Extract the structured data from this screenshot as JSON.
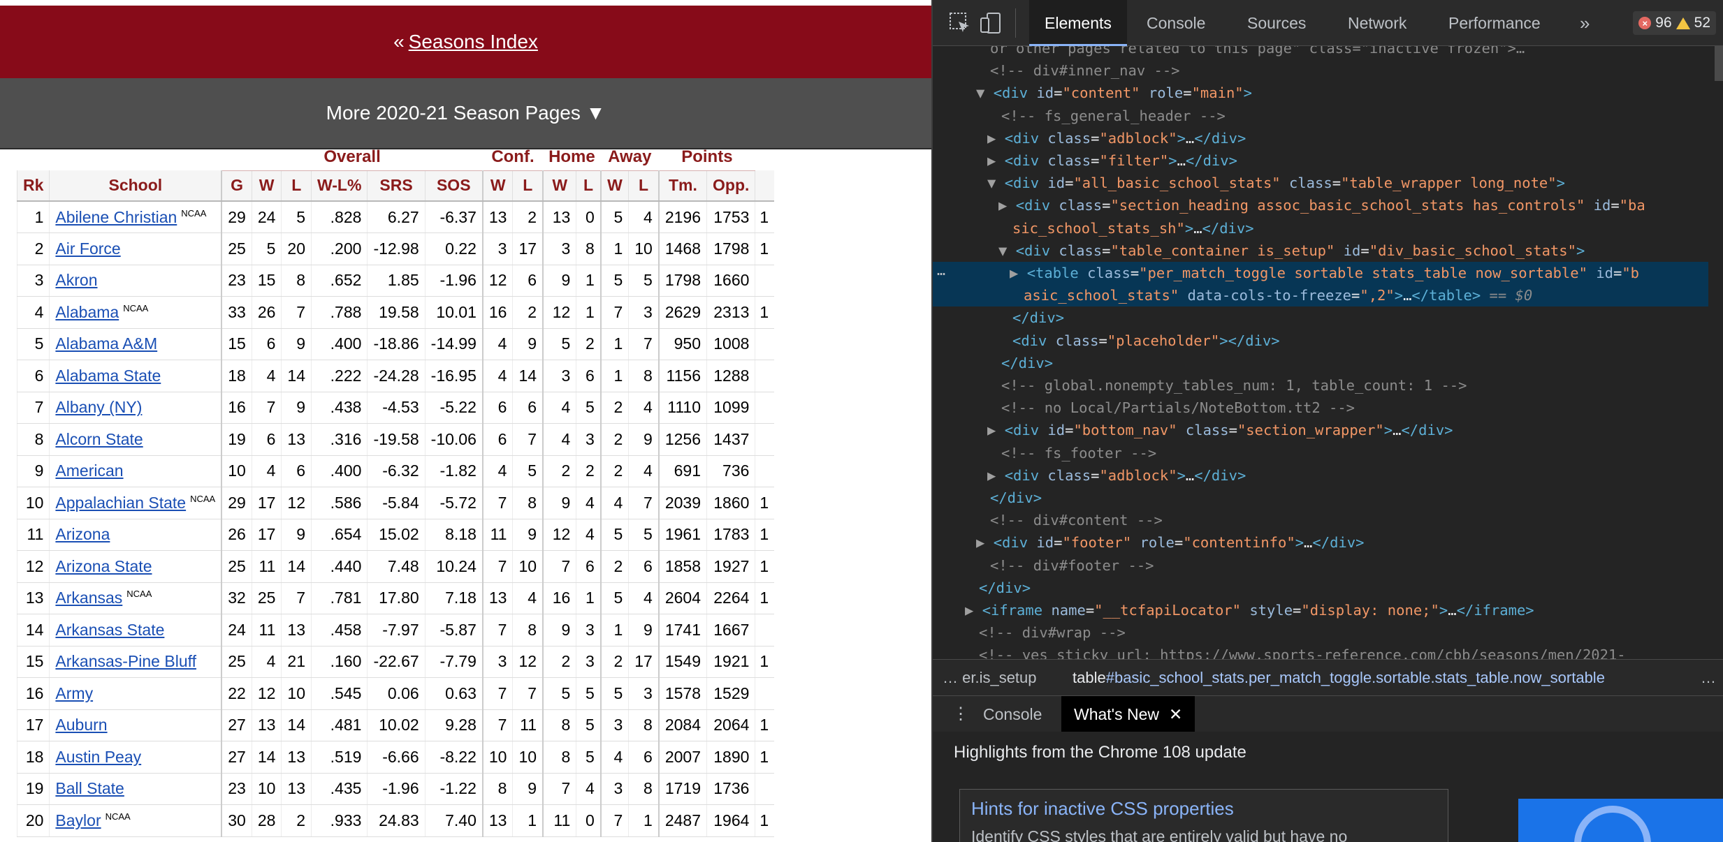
{
  "page": {
    "top_nav": {
      "prefix": "«",
      "link": "Seasons Index"
    },
    "more_pages": {
      "label": "More 2020-21 Season Pages ▼"
    },
    "table": {
      "over_headers": [
        "Overall",
        "Conf.",
        "Home",
        "Away",
        "Points"
      ],
      "headers": [
        "Rk",
        "School",
        "G",
        "W",
        "L",
        "W-L%",
        "SRS",
        "SOS",
        "W",
        "L",
        "W",
        "L",
        "W",
        "L",
        "Tm.",
        "Opp."
      ],
      "rows": [
        {
          "rk": "1",
          "school": "Abilene Christian",
          "ncaa": "NCAA",
          "g": "29",
          "w": "24",
          "l": "5",
          "wl": ".828",
          "srs": "6.27",
          "sos": "-6.37",
          "cw": "13",
          "cl": "2",
          "hw": "13",
          "hl": "0",
          "aw": "5",
          "al": "4",
          "tm": "2196",
          "opp": "1753",
          "more": "1"
        },
        {
          "rk": "2",
          "school": "Air Force",
          "ncaa": "",
          "g": "25",
          "w": "5",
          "l": "20",
          "wl": ".200",
          "srs": "-12.98",
          "sos": "0.22",
          "cw": "3",
          "cl": "17",
          "hw": "3",
          "hl": "8",
          "aw": "1",
          "al": "10",
          "tm": "1468",
          "opp": "1798",
          "more": "1"
        },
        {
          "rk": "3",
          "school": "Akron",
          "ncaa": "",
          "g": "23",
          "w": "15",
          "l": "8",
          "wl": ".652",
          "srs": "1.85",
          "sos": "-1.96",
          "cw": "12",
          "cl": "6",
          "hw": "9",
          "hl": "1",
          "aw": "5",
          "al": "5",
          "tm": "1798",
          "opp": "1660",
          "more": ""
        },
        {
          "rk": "4",
          "school": "Alabama",
          "ncaa": "NCAA",
          "g": "33",
          "w": "26",
          "l": "7",
          "wl": ".788",
          "srs": "19.58",
          "sos": "10.01",
          "cw": "16",
          "cl": "2",
          "hw": "12",
          "hl": "1",
          "aw": "7",
          "al": "3",
          "tm": "2629",
          "opp": "2313",
          "more": "1"
        },
        {
          "rk": "5",
          "school": "Alabama A&M",
          "ncaa": "",
          "g": "15",
          "w": "6",
          "l": "9",
          "wl": ".400",
          "srs": "-18.86",
          "sos": "-14.99",
          "cw": "4",
          "cl": "9",
          "hw": "5",
          "hl": "2",
          "aw": "1",
          "al": "7",
          "tm": "950",
          "opp": "1008",
          "more": ""
        },
        {
          "rk": "6",
          "school": "Alabama State",
          "ncaa": "",
          "g": "18",
          "w": "4",
          "l": "14",
          "wl": ".222",
          "srs": "-24.28",
          "sos": "-16.95",
          "cw": "4",
          "cl": "14",
          "hw": "3",
          "hl": "6",
          "aw": "1",
          "al": "8",
          "tm": "1156",
          "opp": "1288",
          "more": ""
        },
        {
          "rk": "7",
          "school": "Albany (NY)",
          "ncaa": "",
          "g": "16",
          "w": "7",
          "l": "9",
          "wl": ".438",
          "srs": "-4.53",
          "sos": "-5.22",
          "cw": "6",
          "cl": "6",
          "hw": "4",
          "hl": "5",
          "aw": "2",
          "al": "4",
          "tm": "1110",
          "opp": "1099",
          "more": ""
        },
        {
          "rk": "8",
          "school": "Alcorn State",
          "ncaa": "",
          "g": "19",
          "w": "6",
          "l": "13",
          "wl": ".316",
          "srs": "-19.58",
          "sos": "-10.06",
          "cw": "6",
          "cl": "7",
          "hw": "4",
          "hl": "3",
          "aw": "2",
          "al": "9",
          "tm": "1256",
          "opp": "1437",
          "more": ""
        },
        {
          "rk": "9",
          "school": "American",
          "ncaa": "",
          "g": "10",
          "w": "4",
          "l": "6",
          "wl": ".400",
          "srs": "-6.32",
          "sos": "-1.82",
          "cw": "4",
          "cl": "5",
          "hw": "2",
          "hl": "2",
          "aw": "2",
          "al": "4",
          "tm": "691",
          "opp": "736",
          "more": ""
        },
        {
          "rk": "10",
          "school": "Appalachian State",
          "ncaa": "NCAA",
          "g": "29",
          "w": "17",
          "l": "12",
          "wl": ".586",
          "srs": "-5.84",
          "sos": "-5.72",
          "cw": "7",
          "cl": "8",
          "hw": "9",
          "hl": "4",
          "aw": "4",
          "al": "7",
          "tm": "2039",
          "opp": "1860",
          "more": "1"
        },
        {
          "rk": "11",
          "school": "Arizona",
          "ncaa": "",
          "g": "26",
          "w": "17",
          "l": "9",
          "wl": ".654",
          "srs": "15.02",
          "sos": "8.18",
          "cw": "11",
          "cl": "9",
          "hw": "12",
          "hl": "4",
          "aw": "5",
          "al": "5",
          "tm": "1961",
          "opp": "1783",
          "more": "1"
        },
        {
          "rk": "12",
          "school": "Arizona State",
          "ncaa": "",
          "g": "25",
          "w": "11",
          "l": "14",
          "wl": ".440",
          "srs": "7.48",
          "sos": "10.24",
          "cw": "7",
          "cl": "10",
          "hw": "7",
          "hl": "6",
          "aw": "2",
          "al": "6",
          "tm": "1858",
          "opp": "1927",
          "more": "1"
        },
        {
          "rk": "13",
          "school": "Arkansas",
          "ncaa": "NCAA",
          "g": "32",
          "w": "25",
          "l": "7",
          "wl": ".781",
          "srs": "17.80",
          "sos": "7.18",
          "cw": "13",
          "cl": "4",
          "hw": "16",
          "hl": "1",
          "aw": "5",
          "al": "4",
          "tm": "2604",
          "opp": "2264",
          "more": "1"
        },
        {
          "rk": "14",
          "school": "Arkansas State",
          "ncaa": "",
          "g": "24",
          "w": "11",
          "l": "13",
          "wl": ".458",
          "srs": "-7.97",
          "sos": "-5.87",
          "cw": "7",
          "cl": "8",
          "hw": "9",
          "hl": "3",
          "aw": "1",
          "al": "9",
          "tm": "1741",
          "opp": "1667",
          "more": ""
        },
        {
          "rk": "15",
          "school": "Arkansas-Pine Bluff",
          "ncaa": "",
          "g": "25",
          "w": "4",
          "l": "21",
          "wl": ".160",
          "srs": "-22.67",
          "sos": "-7.79",
          "cw": "3",
          "cl": "12",
          "hw": "2",
          "hl": "3",
          "aw": "2",
          "al": "17",
          "tm": "1549",
          "opp": "1921",
          "more": "1"
        },
        {
          "rk": "16",
          "school": "Army",
          "ncaa": "",
          "g": "22",
          "w": "12",
          "l": "10",
          "wl": ".545",
          "srs": "0.06",
          "sos": "0.63",
          "cw": "7",
          "cl": "7",
          "hw": "5",
          "hl": "5",
          "aw": "5",
          "al": "3",
          "tm": "1578",
          "opp": "1529",
          "more": ""
        },
        {
          "rk": "17",
          "school": "Auburn",
          "ncaa": "",
          "g": "27",
          "w": "13",
          "l": "14",
          "wl": ".481",
          "srs": "10.02",
          "sos": "9.28",
          "cw": "7",
          "cl": "11",
          "hw": "8",
          "hl": "5",
          "aw": "3",
          "al": "8",
          "tm": "2084",
          "opp": "2064",
          "more": "1"
        },
        {
          "rk": "18",
          "school": "Austin Peay",
          "ncaa": "",
          "g": "27",
          "w": "14",
          "l": "13",
          "wl": ".519",
          "srs": "-6.66",
          "sos": "-8.22",
          "cw": "10",
          "cl": "10",
          "hw": "8",
          "hl": "5",
          "aw": "4",
          "al": "6",
          "tm": "2007",
          "opp": "1890",
          "more": "1"
        },
        {
          "rk": "19",
          "school": "Ball State",
          "ncaa": "",
          "g": "23",
          "w": "10",
          "l": "13",
          "wl": ".435",
          "srs": "-1.96",
          "sos": "-1.22",
          "cw": "8",
          "cl": "9",
          "hw": "7",
          "hl": "4",
          "aw": "3",
          "al": "8",
          "tm": "1719",
          "opp": "1736",
          "more": ""
        },
        {
          "rk": "20",
          "school": "Baylor",
          "ncaa": "NCAA",
          "g": "30",
          "w": "28",
          "l": "2",
          "wl": ".933",
          "srs": "24.83",
          "sos": "7.40",
          "cw": "13",
          "cl": "1",
          "hw": "11",
          "hl": "0",
          "aw": "7",
          "al": "1",
          "tm": "2487",
          "opp": "1964",
          "more": "1"
        }
      ]
    }
  },
  "devtools": {
    "tabs": [
      "Elements",
      "Console",
      "Sources",
      "Network",
      "Performance"
    ],
    "more_tabs": "»",
    "errors": "96",
    "warnings": "52",
    "dom_lines": [
      {
        "indent": 3,
        "html": "<span class=\"cm\">or other pages related to this page\" class=\"inactive frozen\">…</div></span>"
      },
      {
        "indent": 3,
        "html": "<span class=\"cm\">&lt;!-- div#inner_nav --&gt;</span>"
      },
      {
        "indent": 3,
        "tri": "▼",
        "html": "<span class=\"tg\">&lt;div</span> <span class=\"at\">id</span>=<span class=\"av\">\"content\"</span> <span class=\"at\">role</span>=<span class=\"av\">\"main\"</span><span class=\"tg\">&gt;</span>"
      },
      {
        "indent": 4,
        "html": "<span class=\"cm\">&lt;!-- fs_general_header --&gt;</span>"
      },
      {
        "indent": 4,
        "tri": "▶",
        "html": "<span class=\"tg\">&lt;div</span> <span class=\"at\">class</span>=<span class=\"av\">\"adblock\"</span><span class=\"tg\">&gt;</span>…<span class=\"tg\">&lt;/div&gt;</span>"
      },
      {
        "indent": 4,
        "tri": "▶",
        "html": "<span class=\"tg\">&lt;div</span> <span class=\"at\">class</span>=<span class=\"av\">\"filter\"</span><span class=\"tg\">&gt;</span>…<span class=\"tg\">&lt;/div&gt;</span>"
      },
      {
        "indent": 4,
        "tri": "▼",
        "html": "<span class=\"tg\">&lt;div</span> <span class=\"at\">id</span>=<span class=\"av\">\"all_basic_school_stats\"</span> <span class=\"at\">class</span>=<span class=\"av\">\"table_wrapper long_note\"</span><span class=\"tg\">&gt;</span>"
      },
      {
        "indent": 5,
        "tri": "▶",
        "html": "<span class=\"tg\">&lt;div</span> <span class=\"at\">class</span>=<span class=\"av\">\"section_heading assoc_basic_school_stats has_controls\"</span> <span class=\"at\">id</span>=<span class=\"av\">\"ba</span>"
      },
      {
        "indent": 5,
        "html": "<span class=\"av\">sic_school_stats_sh\"</span><span class=\"tg\">&gt;</span>…<span class=\"tg\">&lt;/div&gt;</span>"
      },
      {
        "indent": 5,
        "tri": "▼",
        "html": "<span class=\"tg\">&lt;div</span> <span class=\"at\">class</span>=<span class=\"av\">\"table_container is_setup\"</span> <span class=\"at\">id</span>=<span class=\"av\">\"div_basic_school_stats\"</span><span class=\"tg\">&gt;</span>"
      },
      {
        "indent": 6,
        "tri": "▶",
        "sel": true,
        "html": "<span class=\"tg\">&lt;table</span> <span class=\"at\">class</span>=<span class=\"av\">\"per_match_toggle sortable stats_table now_sortable\"</span> <span class=\"at\">id</span>=<span class=\"av\">\"b</span>"
      },
      {
        "indent": 6,
        "sel": true,
        "html": "<span class=\"av\">asic_school_stats\"</span> <span class=\"at\">data-cols-to-freeze</span>=<span class=\"av\">\",2\"</span><span class=\"tg\">&gt;</span>…<span class=\"tg\">&lt;/table&gt;</span> <span class=\"eq\">== $0</span>"
      },
      {
        "indent": 5,
        "html": "<span class=\"tg\">&lt;/div&gt;</span>"
      },
      {
        "indent": 5,
        "html": "<span class=\"tg\">&lt;div</span> <span class=\"at\">class</span>=<span class=\"av\">\"placeholder\"</span><span class=\"tg\">&gt;&lt;/div&gt;</span>"
      },
      {
        "indent": 4,
        "html": "<span class=\"tg\">&lt;/div&gt;</span>"
      },
      {
        "indent": 4,
        "html": "<span class=\"cm\">&lt;!-- global.nonempty_tables_num: 1, table_count: 1 --&gt;</span>"
      },
      {
        "indent": 4,
        "html": "<span class=\"cm\">&lt;!-- no Local/Partials/NoteBottom.tt2 --&gt;</span>"
      },
      {
        "indent": 4,
        "tri": "▶",
        "html": "<span class=\"tg\">&lt;div</span> <span class=\"at\">id</span>=<span class=\"av\">\"bottom_nav\"</span> <span class=\"at\">class</span>=<span class=\"av\">\"section_wrapper\"</span><span class=\"tg\">&gt;</span>…<span class=\"tg\">&lt;/div&gt;</span>"
      },
      {
        "indent": 4,
        "html": "<span class=\"cm\">&lt;!-- fs_footer --&gt;</span>"
      },
      {
        "indent": 4,
        "tri": "▶",
        "html": "<span class=\"tg\">&lt;div</span> <span class=\"at\">class</span>=<span class=\"av\">\"adblock\"</span><span class=\"tg\">&gt;</span>…<span class=\"tg\">&lt;/div&gt;</span>"
      },
      {
        "indent": 3,
        "html": "<span class=\"tg\">&lt;/div&gt;</span>"
      },
      {
        "indent": 3,
        "html": "<span class=\"cm\">&lt;!-- div#content --&gt;</span>"
      },
      {
        "indent": 3,
        "tri": "▶",
        "html": "<span class=\"tg\">&lt;div</span> <span class=\"at\">id</span>=<span class=\"av\">\"footer\"</span> <span class=\"at\">role</span>=<span class=\"av\">\"contentinfo\"</span><span class=\"tg\">&gt;</span>…<span class=\"tg\">&lt;/div&gt;</span>"
      },
      {
        "indent": 3,
        "html": "<span class=\"cm\">&lt;!-- div#footer --&gt;</span>"
      },
      {
        "indent": 2,
        "html": "<span class=\"tg\">&lt;/div&gt;</span>"
      },
      {
        "indent": 2,
        "tri": "▶",
        "html": "<span class=\"tg\">&lt;iframe</span> <span class=\"at\">name</span>=<span class=\"av\">\"__tcfapiLocator\"</span> <span class=\"at\">style</span>=<span class=\"av\">\"display: none;\"</span><span class=\"tg\">&gt;</span>…<span class=\"tg\">&lt;/iframe&gt;</span>"
      },
      {
        "indent": 2,
        "html": "<span class=\"cm\">&lt;!-- div#wrap --&gt;</span>"
      },
      {
        "indent": 2,
        "html": "<span class=\"cm\">&lt;!-- yes sticky url: https://www.sports-reference.com/cbb/seasons/men/2021-</span>"
      }
    ],
    "selected_dots": "…",
    "breadcrumb": {
      "left": "… er.is_setup",
      "tag": "table",
      "path": "#basic_school_stats.per_match_toggle.sortable.stats_table.now_sortable",
      "more": "…"
    },
    "drawer": {
      "menu": "⋮",
      "tabs": [
        "Console",
        "What's New"
      ],
      "close": "✕",
      "heading": "Highlights from the Chrome 108 update",
      "card_title": "Hints for inactive CSS properties",
      "card_desc": "Identify CSS styles that are entirely valid but have no"
    }
  }
}
